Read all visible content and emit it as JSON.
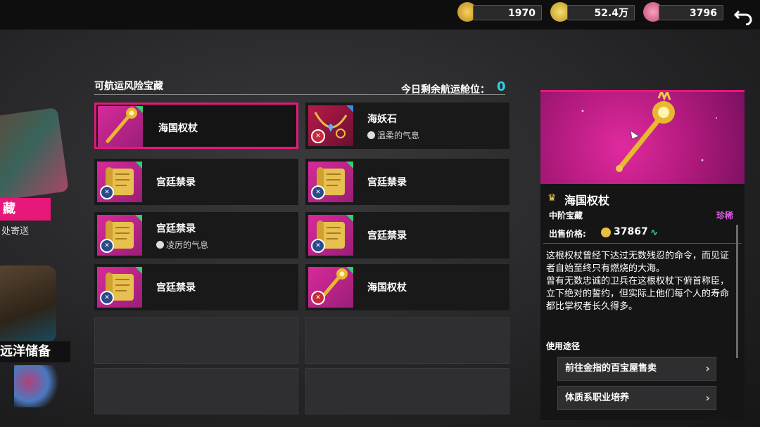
{
  "currencies": [
    {
      "icon": "gold-coin-icon",
      "value": "1970"
    },
    {
      "icon": "gold-crown-icon",
      "value": "52.4万"
    },
    {
      "icon": "pink-crystal-icon",
      "value": "3796"
    }
  ],
  "left_side": {
    "tab_label": "藏",
    "tab_sub": "处寄送",
    "section2_label": "远洋储备"
  },
  "main": {
    "section_title": "可航运风险宝藏",
    "capacity_label": "今日剩余航运舱位：",
    "capacity_value": "0",
    "items": [
      {
        "name": "海国权杖",
        "sub": "",
        "type": "scepter",
        "selected": true
      },
      {
        "name": "海妖石",
        "sub": "温柔的气息",
        "type": "necklace",
        "selected": false
      },
      {
        "name": "宫廷禁录",
        "sub": "",
        "type": "scroll",
        "selected": false
      },
      {
        "name": "宫廷禁录",
        "sub": "",
        "type": "scroll",
        "selected": false
      },
      {
        "name": "宫廷禁录",
        "sub": "凌厉的气息",
        "type": "scroll",
        "selected": false
      },
      {
        "name": "宫廷禁录",
        "sub": "",
        "type": "scroll",
        "selected": false
      },
      {
        "name": "宫廷禁录",
        "sub": "",
        "type": "scroll",
        "selected": false
      },
      {
        "name": "海国权杖",
        "sub": "",
        "type": "scepter",
        "selected": false
      }
    ]
  },
  "detail": {
    "name": "海国权杖",
    "tier": "中阶宝藏",
    "rarity": "珍稀",
    "price_label": "出售价格:",
    "price": "37867",
    "description": [
      "这根权杖曾经下达过无数残忍的命令，而见证者自始至终只有燃烧的大海。",
      "曾有无数忠诚的卫兵在这根权杖下俯首称臣，立下绝对的誓约，但实际上他们每个人的寿命都比掌权者长久得多。"
    ],
    "usage_label": "使用途径",
    "usage": [
      "前往金指的百宝屋售卖",
      "体质系职业培养"
    ]
  },
  "colors": {
    "accent": "#e8177a",
    "capacity": "#29d4e8",
    "rarity": "#e05ae8"
  }
}
